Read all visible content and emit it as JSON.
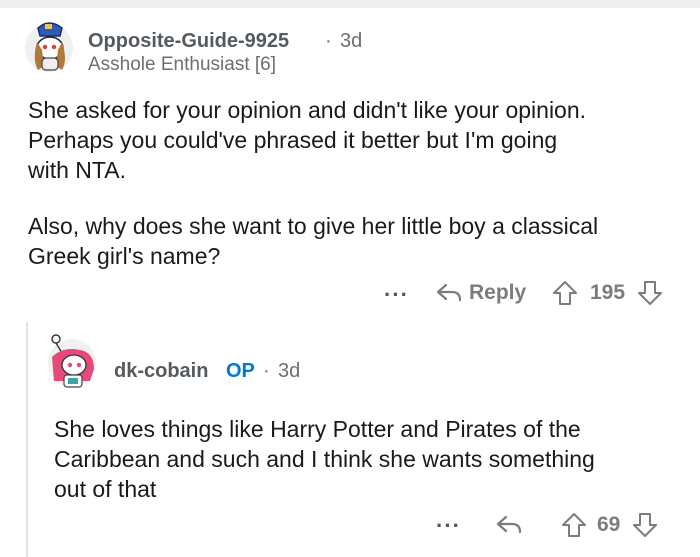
{
  "comment": {
    "username": "Opposite-Guide-9925",
    "separator": "·",
    "age": "3d",
    "flair": "Asshole Enthusiast [6]",
    "paragraphs": [
      [
        "She asked for your opinion and didn't like your opinion.",
        "Perhaps you could've phrased it better but I'm going",
        "with NTA."
      ],
      [
        "Also, why does she want to give her little boy a classical",
        "Greek girl's name?"
      ]
    ],
    "more": "···",
    "reply_label": "Reply",
    "score": "195"
  },
  "reply": {
    "username": "dk-cobain",
    "op_badge": "OP",
    "separator": "·",
    "age": "3d",
    "lines": [
      "She loves things like Harry Potter and Pirates of the",
      "Caribbean and such and I think she wants something",
      "out of that"
    ],
    "more": "···",
    "score": "69"
  },
  "colors": {
    "op_blue": "#0079d3",
    "meta_gray": "#6b6f73",
    "action_gray": "#7c7c7c"
  },
  "icons": [
    "snoo-avatar",
    "reply-arrow-icon",
    "upvote-icon",
    "downvote-icon"
  ]
}
